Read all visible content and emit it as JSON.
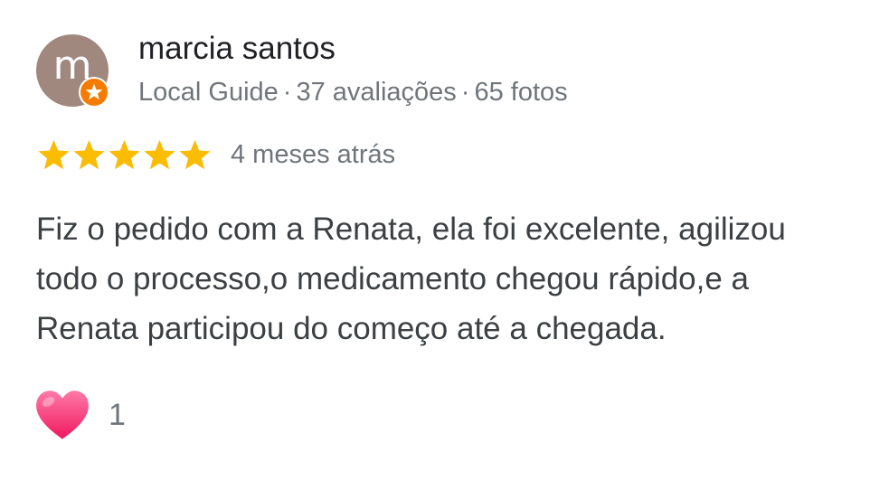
{
  "review": {
    "author": {
      "initial": "m",
      "name": "marcia santos",
      "avatar_color": "#a1887f"
    },
    "meta": {
      "badge": "Local Guide",
      "separator": "·",
      "reviews": "37 avaliações",
      "photos": "65 fotos",
      "badge_icon": "local-guide-star-icon",
      "badge_color": "#f57c00"
    },
    "rating": {
      "value": 5,
      "max": 5,
      "star_color": "#fbbc04"
    },
    "time_ago": "4 meses atrás",
    "text_lines": [
      "Fiz o pedido com a Renata, ela foi excelente, agilizou",
      "todo o processo,o medicamento chegou rápido,e a",
      "Renata participou do começo até a chegada."
    ],
    "reactions": {
      "icon": "heart-icon",
      "count": "1"
    }
  }
}
